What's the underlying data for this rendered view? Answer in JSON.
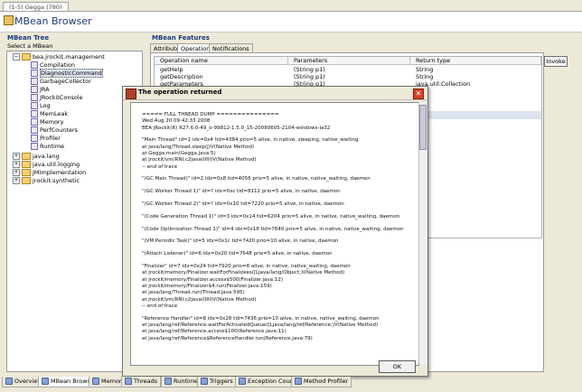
{
  "window": {
    "title_tab": "(1-5) Gegga (780)",
    "header_title": "MBean Browser"
  },
  "mbean_tree": {
    "title": "MBean Tree",
    "subtitle": "Select a MBean",
    "root": "bea.jrockit.management",
    "children": [
      "Compilation",
      "DiagnosticCommand",
      "GarbageCollector",
      "JRA",
      "JRockitConsole",
      "Log",
      "MemLeak",
      "Memory",
      "PerfCounters",
      "Profiler",
      "Runtime"
    ],
    "others": [
      "java.lang",
      "java.util.logging",
      "JMImplementation",
      "jrockit.synthetic"
    ]
  },
  "features": {
    "title": "MBean Features",
    "tabs": [
      "Attributes",
      "Operations",
      "Notifications"
    ],
    "columns": [
      "Operation name",
      "Parameters",
      "Return type"
    ],
    "rows": [
      [
        "getHelp",
        "(String p1)",
        "String"
      ],
      [
        "getDescription",
        "(String p1)",
        "String"
      ],
      [
        "getParameters",
        "(String p1)",
        "java.util.Collection"
      ]
    ],
    "invoke_label": "Invoke"
  },
  "dialog": {
    "title": "The operation returned",
    "ok_label": "OK",
    "lines": [
      "===== FULL THREAD DUMP ===============",
      "Wed Aug 20 09:42:33 2008",
      "BEA JRockit(R) R27.6.0-49_o-99812-1.5.0_15-20080605-2104-windows-ia32",
      "",
      "\"Main Thread\" id=1 idx=0x4 tid=4384 prio=5 alive, in native, sleeping, native_waiting",
      "    at java/lang/Thread.sleep(J)V(Native Method)",
      "    at Gegga.main(Gegga.java:5)",
      "    at jrockit/vm/RNI.c2java(IIIII)V(Native Method)",
      "    -- end of trace",
      "",
      "\"(GC Main Thread)\" id=2 idx=0x8 tid=4056 prio=5 alive, in native, native_waiting, daemon",
      "",
      "\"(GC Worker Thread 1)\" id=? idx=0xc tid=8112 prio=5 alive, in native, daemon",
      "",
      "\"(GC Worker Thread 2)\" id=? idx=0x10 tid=7220 prio=5 alive, in native, daemon",
      "",
      "\"(Code Generation Thread 1)\" id=3 idx=0x14 tid=6204 prio=5 alive, in native, native_waiting, daemon",
      "",
      "\"(Code Optimization Thread 1)\" id=4 idx=0x18 tid=7640 prio=5 alive, in native, native_waiting, daemon",
      "",
      "\"(VM Periodic Task)\" id=5 idx=0x1c tid=7420 prio=10 alive, in native, daemon",
      "",
      "\"(Attach Listener)\" id=6 idx=0x20 tid=7648 prio=5 alive, in native, daemon",
      "",
      "\"Finalizer\" id=7 idx=0x24 tid=7920 prio=8 alive, in native, native_waiting, daemon",
      "    at jrockit/memory/Finalizer.waitForFinalizees([Ljava/lang/Object;)I(Native Method)",
      "    at jrockit/memory/Finalizer.access$500(Finalizer.java:12)",
      "    at jrockit/memory/Finalizer$4.run(Finalizer.java:159)",
      "    at java/lang/Thread.run(Thread.java:595)",
      "    at jrockit/vm/RNI.c2java(IIIII)V(Native Method)",
      "    -- end of trace",
      "",
      "\"Reference Handler\" id=8 idx=0x28 tid=7436 prio=10 alive, in native, native_waiting, daemon",
      "    at java/lang/ref/Reference.waitForActivatedQueue([Ljava/lang/ref/Reference;)V(Native Method)",
      "    at java/lang/ref/Reference.access$100(Reference.java:11)",
      "    at java/lang/ref/Reference$ReferenceHandler.run(Reference.java:79)"
    ]
  },
  "bottom_tabs": [
    "Overview",
    "MBean Browser",
    "Memory",
    "Threads",
    "Runtime",
    "Triggers",
    "Exception Count",
    "Method Profiler"
  ],
  "active_bottom_tab": "MBean Browser"
}
